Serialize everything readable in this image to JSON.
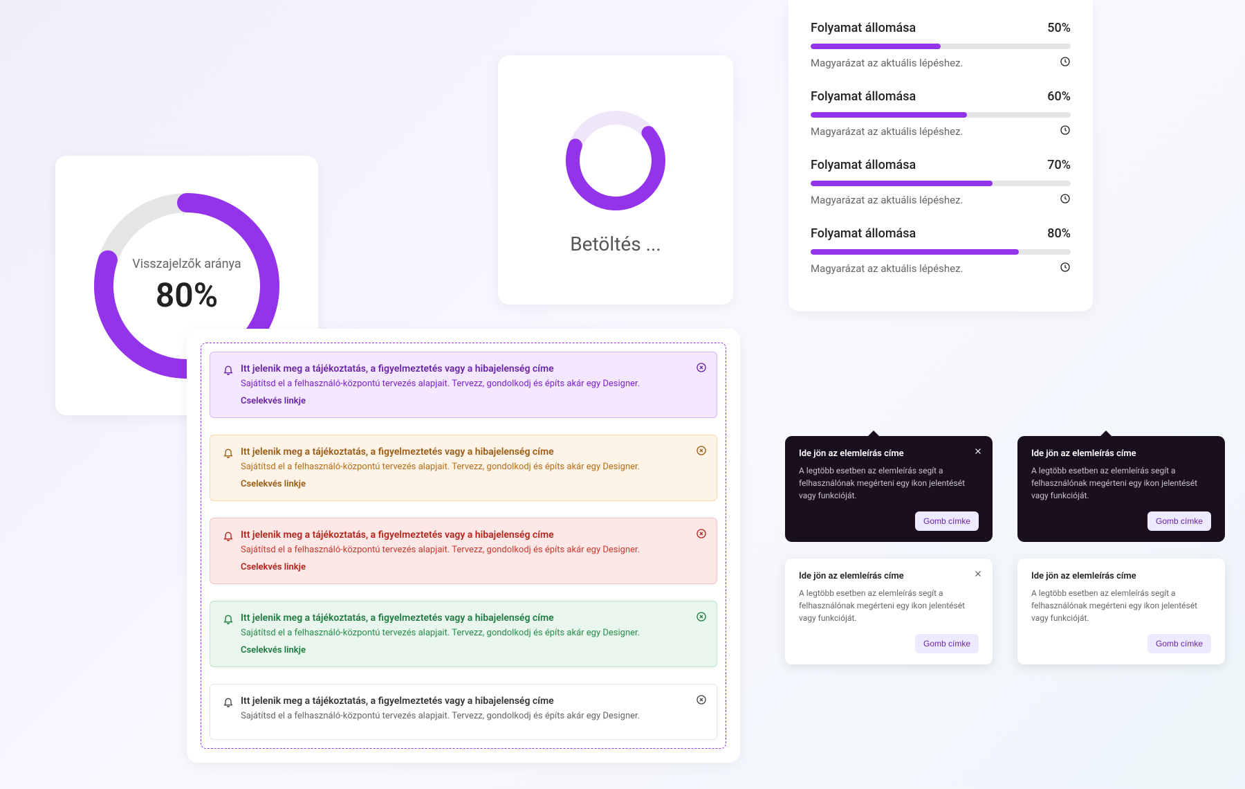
{
  "donut": {
    "label": "Visszajelzők aránya",
    "value": "80%",
    "percent": 80
  },
  "loading": {
    "label": "Betöltés ..."
  },
  "progress": {
    "items": [
      {
        "title": "Folyamat állomása",
        "pct_label": "50%",
        "pct": 50,
        "desc": "Magyarázat az aktuális lépéshez."
      },
      {
        "title": "Folyamat állomása",
        "pct_label": "60%",
        "pct": 60,
        "desc": "Magyarázat az aktuális lépéshez."
      },
      {
        "title": "Folyamat állomása",
        "pct_label": "70%",
        "pct": 70,
        "desc": "Magyarázat az aktuális lépéshez."
      },
      {
        "title": "Folyamat állomása",
        "pct_label": "80%",
        "pct": 80,
        "desc": "Magyarázat az aktuális lépéshez."
      }
    ]
  },
  "alerts": {
    "items": [
      {
        "variant": "purple",
        "title": "Itt jelenik meg a tájékoztatás, a figyelmeztetés vagy a hibajelenség címe",
        "desc": "Sajátítsd el a felhasználó-központú tervezés alapjait. Tervezz, gondolkodj és építs akár egy Designer.",
        "link": "Cselekvés linkje"
      },
      {
        "variant": "orange",
        "title": "Itt jelenik meg a tájékoztatás, a figyelmeztetés vagy a hibajelenség címe",
        "desc": "Sajátítsd el a felhasználó-központú tervezés alapjait. Tervezz, gondolkodj és építs akár egy Designer.",
        "link": "Cselekvés linkje"
      },
      {
        "variant": "red",
        "title": "Itt jelenik meg a tájékoztatás, a figyelmeztetés vagy a hibajelenség címe",
        "desc": "Sajátítsd el a felhasználó-központú tervezés alapjait. Tervezz, gondolkodj és építs akár egy Designer.",
        "link": "Cselekvés linkje"
      },
      {
        "variant": "green",
        "title": "Itt jelenik meg a tájékoztatás, a figyelmeztetés vagy a hibajelenség címe",
        "desc": "Sajátítsd el a felhasználó-központú tervezés alapjait. Tervezz, gondolkodj és építs akár egy Designer.",
        "link": "Cselekvés linkje"
      },
      {
        "variant": "gray",
        "title": "Itt jelenik meg a tájékoztatás, a figyelmeztetés vagy a hibajelenség címe",
        "desc": "Sajátítsd el a felhasználó-központú tervezés alapjait. Tervezz, gondolkodj és építs akár egy Designer.",
        "link": ""
      }
    ]
  },
  "tooltips": {
    "items": [
      {
        "theme": "dark",
        "title": "Ide jön az elemleírás címe",
        "desc": "A legtöbb esetben az elemleírás segít a felhasználónak megérteni egy ikon jelentését vagy funkcióját.",
        "button": "Gomb címke",
        "closeable": true
      },
      {
        "theme": "dark",
        "title": "Ide jön az elemleírás címe",
        "desc": "A legtöbb esetben az elemleírás segít a felhasználónak megérteni egy ikon jelentését vagy funkcióját.",
        "button": "Gomb címke",
        "closeable": false
      },
      {
        "theme": "light",
        "title": "Ide jön az elemleírás címe",
        "desc": "A legtöbb esetben az elemleírás segít a felhasználónak megérteni egy ikon jelentését vagy funkcióját.",
        "button": "Gomb címke",
        "closeable": true
      },
      {
        "theme": "light",
        "title": "Ide jön az elemleírás címe",
        "desc": "A legtöbb esetben az elemleírás segít a felhasználónak megérteni egy ikon jelentését vagy funkcióját.",
        "button": "Gomb címke",
        "closeable": false
      }
    ]
  },
  "colors": {
    "accent": "#9333ea"
  }
}
